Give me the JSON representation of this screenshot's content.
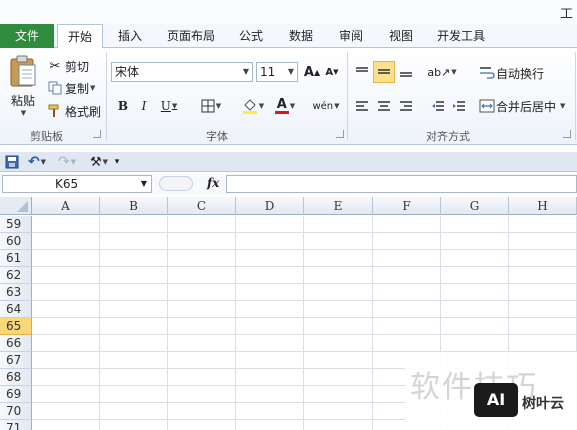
{
  "window": {
    "title_partial": "工"
  },
  "tabs": [
    {
      "label": "文件"
    },
    {
      "label": "开始"
    },
    {
      "label": "插入"
    },
    {
      "label": "页面布局"
    },
    {
      "label": "公式"
    },
    {
      "label": "数据"
    },
    {
      "label": "审阅"
    },
    {
      "label": "视图"
    },
    {
      "label": "开发工具"
    }
  ],
  "clipboard": {
    "paste_label": "粘贴",
    "cut_label": "剪切",
    "copy_label": "复制",
    "format_painter_label": "格式刷",
    "group_label": "剪贴板"
  },
  "font": {
    "name": "宋体",
    "size": "11",
    "bold": "B",
    "italic": "I",
    "underline": "U",
    "grow": "A",
    "shrink": "A",
    "font_color_letter": "A",
    "phonetic": "wén",
    "group_label": "字体"
  },
  "alignment": {
    "wrap_text_label": "自动换行",
    "merge_center_label": "合并后居中",
    "group_label": "对齐方式"
  },
  "formula_bar": {
    "name_box": "K65",
    "fx": "fx",
    "formula": ""
  },
  "grid": {
    "columns": [
      "A",
      "B",
      "C",
      "D",
      "E",
      "F",
      "G",
      "H"
    ],
    "rows": [
      "59",
      "60",
      "61",
      "62",
      "63",
      "64",
      "65",
      "66",
      "67",
      "68",
      "69",
      "70",
      "71"
    ],
    "selected_row": "65"
  },
  "watermark": {
    "text": "软件技巧",
    "logo": "AI",
    "brand": "树叶云"
  },
  "colors": {
    "file_tab": "#2f8c3f",
    "selection": "#f9d77c",
    "highlight": "#ffef3a",
    "font_color": "#e0161c"
  }
}
